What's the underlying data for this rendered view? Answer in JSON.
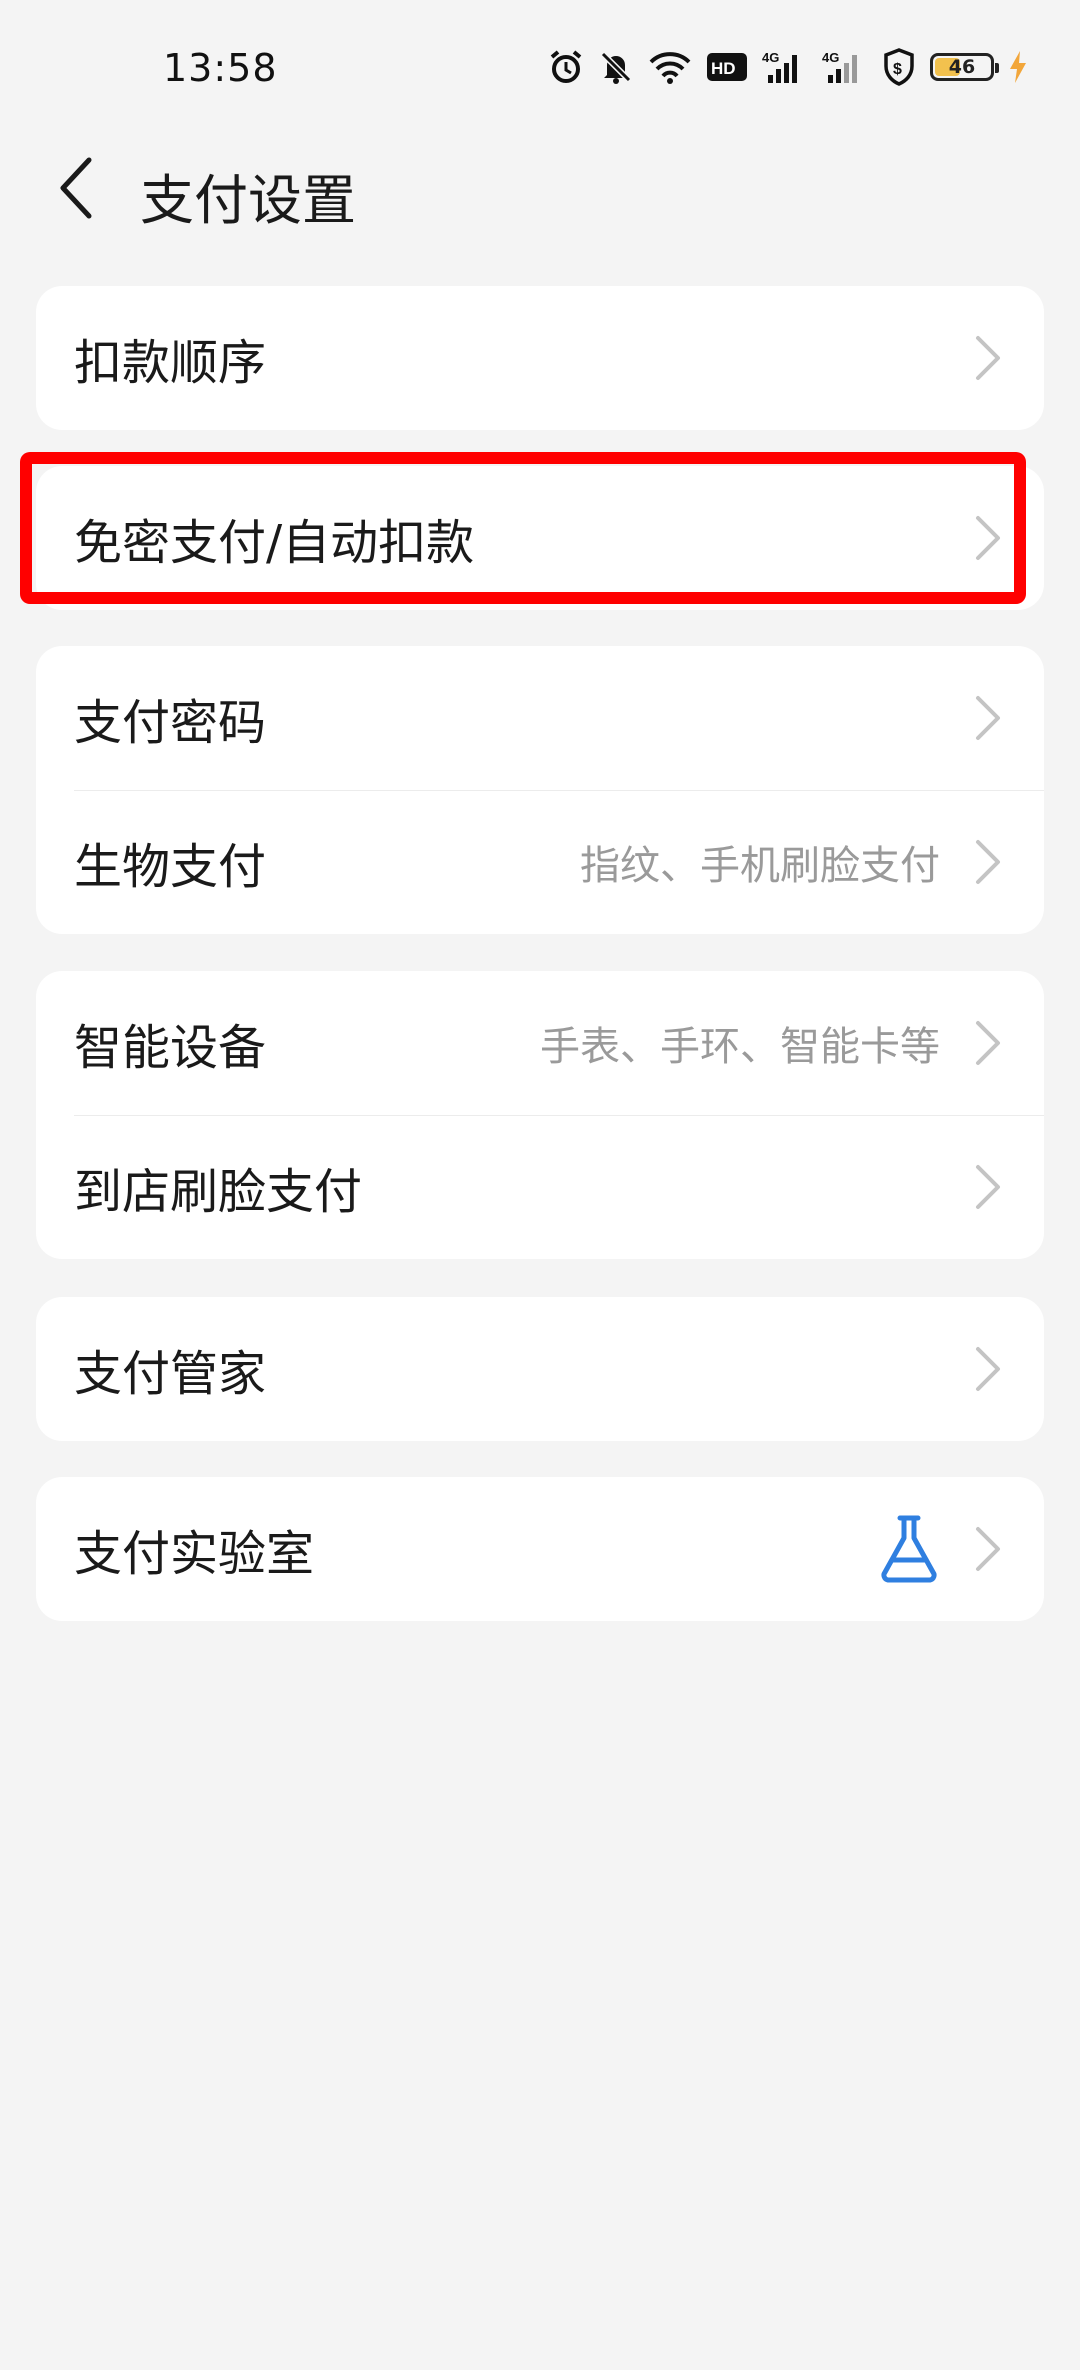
{
  "status_bar": {
    "time": "13:58",
    "icons": [
      "alarm-icon",
      "mute-icon",
      "wifi-icon",
      "hd-icon",
      "signal-4g-icon",
      "signal-4g-icon",
      "shield-dollar-icon",
      "battery-icon",
      "charging-icon"
    ],
    "battery_level": "46",
    "battery_fraction": 0.46,
    "battery_color": "#f2c14e"
  },
  "header": {
    "title": "支付设置"
  },
  "groups": [
    {
      "items": [
        {
          "label": "扣款顺序"
        }
      ]
    },
    {
      "items": [
        {
          "label": "免密支付/自动扣款"
        }
      ]
    },
    {
      "items": [
        {
          "label": "支付密码"
        },
        {
          "label": "生物支付",
          "sub": "指纹、手机刷脸支付"
        }
      ]
    },
    {
      "items": [
        {
          "label": "智能设备",
          "sub": "手表、手环、智能卡等"
        },
        {
          "label": "到店刷脸支付"
        }
      ]
    },
    {
      "items": [
        {
          "label": "支付管家"
        }
      ]
    },
    {
      "items": [
        {
          "label": "支付实验室",
          "icon": "flask-icon"
        }
      ]
    }
  ],
  "colors": {
    "highlight": "#ff0000",
    "flask": "#2f7fe0",
    "chevron": "#c4c4c4"
  }
}
